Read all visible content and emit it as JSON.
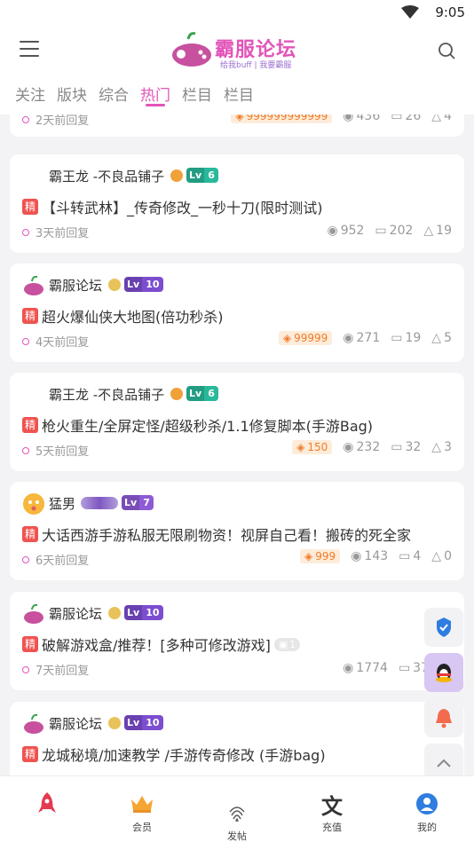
{
  "status": {
    "time": "9:05"
  },
  "header": {
    "title": "霸服论坛",
    "subtitle": "给我buff | 我要霸服"
  },
  "tabs": [
    {
      "label": "关注",
      "active": false
    },
    {
      "label": "版块",
      "active": false
    },
    {
      "label": "综合",
      "active": false
    },
    {
      "label": "热门",
      "active": true
    },
    {
      "label": "栏目",
      "active": false
    },
    {
      "label": "栏目",
      "active": false
    }
  ],
  "posts": [
    {
      "author": "",
      "level": "",
      "title": "",
      "time": "2天前回复",
      "coins": "999999999999",
      "views": "436",
      "comments": "26",
      "likes": "4"
    },
    {
      "author": "霸王龙 -不良品铺子",
      "level": "6",
      "title": "【斗转武林】_传奇修改_一秒十刀(限时测试)",
      "jing": "精",
      "time": "3天前回复",
      "coins": "",
      "views": "952",
      "comments": "202",
      "likes": "19"
    },
    {
      "author": "霸服论坛",
      "level": "10",
      "title": "超火爆仙侠大地图(倍功秒杀)",
      "jing": "精",
      "time": "4天前回复",
      "coins": "99999",
      "views": "271",
      "comments": "19",
      "likes": "5"
    },
    {
      "author": "霸王龙 -不良品铺子",
      "level": "6",
      "title": "枪火重生/全屏定怪/超级秒杀/1.1修复脚本(手游Bag)",
      "jing": "精",
      "time": "5天前回复",
      "coins": "150",
      "views": "232",
      "comments": "32",
      "likes": "3"
    },
    {
      "author": "猛男",
      "level": "7",
      "title": "大话西游手游私服无限刷物资！视屏自己看！搬砖的死全家",
      "jing": "精",
      "time": "6天前回复",
      "coins": "999",
      "views": "143",
      "comments": "4",
      "likes": "0"
    },
    {
      "author": "霸服论坛",
      "level": "10",
      "title": "破解游戏盒/推荐！[多种可修改游戏]",
      "jing": "精",
      "img_count": "1",
      "time": "7天前回复",
      "coins": "",
      "views": "1774",
      "comments": "37",
      "likes": ""
    },
    {
      "author": "霸服论坛",
      "level": "10",
      "title": "龙城秘境/加速教学 /手游传奇修改 (手游bag)",
      "jing": "精",
      "time": "",
      "coins": "",
      "views": "",
      "comments": "",
      "likes": ""
    }
  ],
  "lv_prefix": "Lv",
  "bottom_nav": [
    {
      "label": "",
      "icon": "rocket-icon"
    },
    {
      "label": "会员",
      "icon": "crown-icon"
    },
    {
      "label": "发帖",
      "icon": "fingerprint-icon"
    },
    {
      "label": "充值",
      "icon": "wen-icon"
    },
    {
      "label": "我的",
      "icon": "profile-icon"
    }
  ],
  "colors": {
    "accent": "#e255b9",
    "level_green": "#29b99a",
    "level_purple": "#7c4dcf",
    "jing_red": "#ef5350",
    "coin_orange": "#f07b2a"
  }
}
